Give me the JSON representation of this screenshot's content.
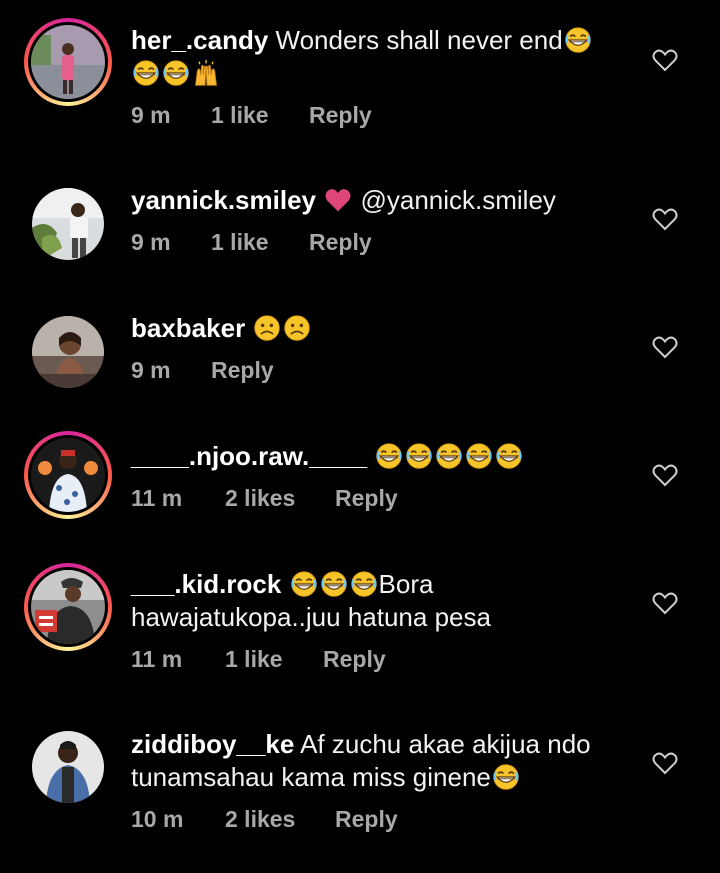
{
  "comments": [
    {
      "username": "her_.candy",
      "text": "Wonders shall never end",
      "emojis_inline": [
        "grin-emoji"
      ],
      "emojis_line2": [
        "grin-emoji",
        "grin-emoji",
        "raised-hands-emoji"
      ],
      "time": "9 m",
      "likes": "1 like",
      "reply": "Reply",
      "story_ring": true
    },
    {
      "username": "yannick.smiley",
      "text": "@yannick.smiley",
      "emojis_inline": [
        "pink-heart-emoji"
      ],
      "time": "9 m",
      "likes": "1 like",
      "reply": "Reply",
      "story_ring": false
    },
    {
      "username": "baxbaker",
      "text": "",
      "emojis_inline": [
        "frown-emoji",
        "frown-emoji"
      ],
      "time": "9 m",
      "likes": "",
      "reply": "Reply",
      "story_ring": false
    },
    {
      "username": "____.njoo.raw.____",
      "text": "",
      "emojis_inline": [
        "grin-emoji",
        "grin-emoji",
        "grin-emoji",
        "grin-emoji",
        "grin-emoji"
      ],
      "time": "11 m",
      "likes": "2 likes",
      "reply": "Reply",
      "story_ring": true
    },
    {
      "username": "___.kid.rock",
      "text": "Bora",
      "text_line2": "hawajatukopa..juu hatuna pesa",
      "emojis_inline": [
        "grin-emoji",
        "grin-emoji",
        "grin-emoji"
      ],
      "time": "11 m",
      "likes": "1 like",
      "reply": "Reply",
      "story_ring": true
    },
    {
      "username": "ziddiboy__ke",
      "text": "Af zuchu akae akijua ndo",
      "text_line2": "tunamsahau kama miss ginene",
      "emojis_inline": [
        "grin-emoji"
      ],
      "time": "10 m",
      "likes": "2 likes",
      "reply": "Reply",
      "story_ring": false
    }
  ],
  "colors": {
    "background": "#000000",
    "text": "#f2f2f2",
    "meta": "#a8a8a8",
    "heart_emoji": "#e0457b",
    "emoji_yellow": "#f7c52a"
  },
  "icons": {
    "like": "heart-outline-icon"
  }
}
